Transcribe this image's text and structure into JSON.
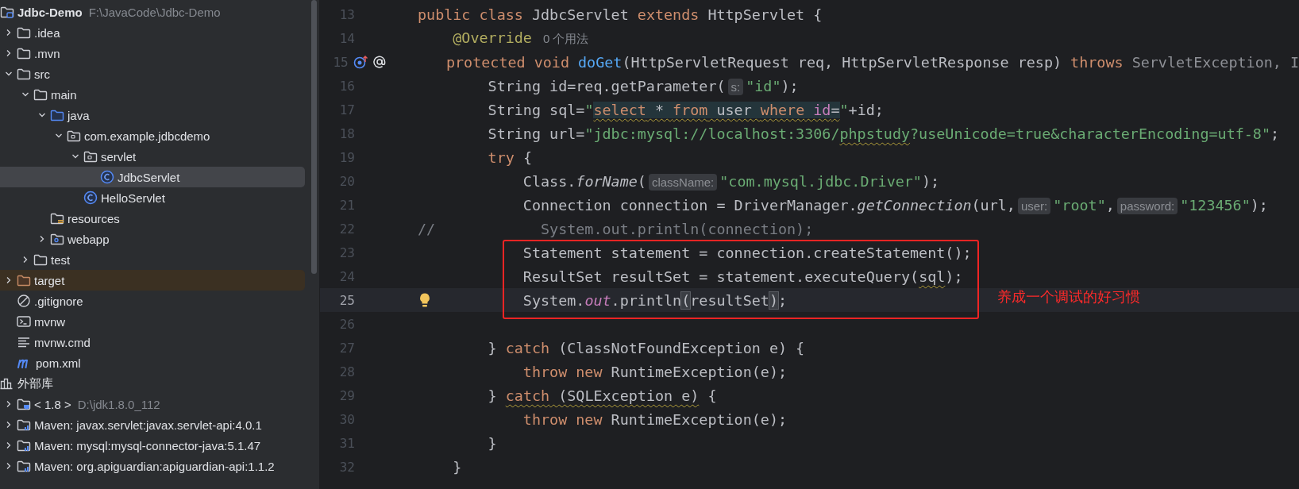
{
  "project_tree": [
    {
      "label": "Jdbc-Demo",
      "secondary": "F:\\JavaCode\\Jdbc-Demo",
      "kind": "project",
      "selected": false,
      "children": [
        {
          "label": ".idea",
          "kind": "folder",
          "expanded": false,
          "selected": false
        },
        {
          "label": ".mvn",
          "kind": "folder",
          "expanded": false,
          "selected": false
        },
        {
          "label": "src",
          "kind": "folder",
          "expanded": true,
          "selected": false,
          "children": [
            {
              "label": "main",
              "kind": "folder",
              "expanded": true,
              "selected": false,
              "children": [
                {
                  "label": "java",
                  "kind": "source-folder",
                  "expanded": true,
                  "selected": false,
                  "children": [
                    {
                      "label": "com.example.jdbcdemo",
                      "kind": "package",
                      "expanded": true,
                      "selected": false,
                      "children": [
                        {
                          "label": "servlet",
                          "kind": "package",
                          "expanded": true,
                          "selected": false,
                          "children": [
                            {
                              "label": "JdbcServlet",
                              "kind": "class",
                              "selected": true
                            }
                          ]
                        },
                        {
                          "label": "HelloServlet",
                          "kind": "class",
                          "selected": false
                        }
                      ]
                    }
                  ]
                },
                {
                  "label": "resources",
                  "kind": "resources",
                  "selected": false
                },
                {
                  "label": "webapp",
                  "kind": "web-folder",
                  "expanded": false,
                  "selected": false
                }
              ]
            },
            {
              "label": "test",
              "kind": "folder",
              "expanded": false,
              "selected": false
            }
          ]
        },
        {
          "label": "target",
          "kind": "excluded-folder",
          "expanded": false,
          "selected": false
        },
        {
          "label": ".gitignore",
          "kind": "ignore",
          "selected": false
        },
        {
          "label": "mvnw",
          "kind": "terminal",
          "selected": false
        },
        {
          "label": "mvnw.cmd",
          "kind": "text",
          "selected": false
        },
        {
          "label": "pom.xml",
          "kind": "maven",
          "selected": false
        }
      ]
    },
    {
      "label": "外部库",
      "kind": "library",
      "selected": false,
      "children": [
        {
          "label": "< 1.8 >",
          "secondary": "D:\\jdk1.8.0_112",
          "kind": "jdk",
          "expanded": false,
          "selected": false
        },
        {
          "label": "Maven: javax.servlet:javax.servlet-api:4.0.1",
          "kind": "maven-lib",
          "expanded": false,
          "selected": false
        },
        {
          "label": "Maven: mysql:mysql-connector-java:5.1.47",
          "kind": "maven-lib",
          "expanded": false,
          "selected": false
        },
        {
          "label": "Maven: org.apiguardian:apiguardian-api:1.1.2",
          "kind": "maven-lib",
          "expanded": false,
          "selected": false
        }
      ]
    }
  ],
  "editor": {
    "lines": [
      {
        "number": "13",
        "current": false,
        "tokens": [
          {
            "text": "public class ",
            "kind": "kw"
          },
          {
            "text": "JdbcServlet ",
            "kind": "plain"
          },
          {
            "text": "extends ",
            "kind": "kw"
          },
          {
            "text": "HttpServlet {",
            "kind": "plain"
          }
        ]
      },
      {
        "number": "14",
        "current": false,
        "tokens": [
          {
            "text": "    @Override",
            "kind": "ann"
          },
          {
            "text": "0 个用法",
            "kind": "usage"
          }
        ]
      },
      {
        "number": "15",
        "current": false,
        "markers": [
          {
            "kind": "override"
          },
          {
            "kind": "annotation"
          }
        ],
        "tokens": [
          {
            "text": "    protected void ",
            "kind": "kw"
          },
          {
            "text": "doGet",
            "kind": "fn"
          },
          {
            "text": "(HttpServletRequest req, HttpServletResponse resp) ",
            "kind": "plain"
          },
          {
            "text": "throws ",
            "kind": "kw"
          },
          {
            "text": "ServletException, I",
            "kind": "muted"
          }
        ]
      },
      {
        "number": "16",
        "current": false,
        "tokens": [
          {
            "text": "        String id=req.getParameter(",
            "kind": "plain"
          },
          {
            "text": "s:",
            "kind": "hint"
          },
          {
            "text": "\"id\"",
            "kind": "str"
          },
          {
            "text": ");",
            "kind": "plain"
          }
        ]
      },
      {
        "number": "17",
        "current": false,
        "tokens": [
          {
            "text": "        String sql=",
            "kind": "plain"
          },
          {
            "text": "\"",
            "kind": "str"
          },
          {
            "text": "select",
            "kind": "kw",
            "wavy": true,
            "injected": true
          },
          {
            "text": " * ",
            "kind": "plain",
            "wavy": true,
            "injected": true
          },
          {
            "text": "from",
            "kind": "kw",
            "wavy": true,
            "injected": true
          },
          {
            "text": " user ",
            "kind": "plain",
            "wavy": true,
            "injected": true
          },
          {
            "text": "where",
            "kind": "kw",
            "wavy": true,
            "injected": true
          },
          {
            "text": " id",
            "kind": "field",
            "wavy": true,
            "injected": true
          },
          {
            "text": "=",
            "kind": "plain",
            "wavy": true,
            "injected": true
          },
          {
            "text": "\"",
            "kind": "str"
          },
          {
            "text": "+id;",
            "kind": "plain"
          }
        ]
      },
      {
        "number": "18",
        "current": false,
        "tokens": [
          {
            "text": "        String url=",
            "kind": "plain"
          },
          {
            "text": "\"jdbc:mysql://localhost:3306/",
            "kind": "str"
          },
          {
            "text": "phpstudy",
            "kind": "str",
            "wavy": true
          },
          {
            "text": "?useUnicode=true&characterEncoding=utf-8\"",
            "kind": "str"
          },
          {
            "text": ";",
            "kind": "plain"
          }
        ]
      },
      {
        "number": "19",
        "current": false,
        "tokens": [
          {
            "text": "        try ",
            "kind": "kw"
          },
          {
            "text": "{",
            "kind": "plain"
          }
        ]
      },
      {
        "number": "20",
        "current": false,
        "tokens": [
          {
            "text": "            Class.",
            "kind": "plain"
          },
          {
            "text": "forName",
            "kind": "italic"
          },
          {
            "text": "(",
            "kind": "plain"
          },
          {
            "text": "className:",
            "kind": "hint"
          },
          {
            "text": "\"com.mysql.jdbc.Driver\"",
            "kind": "str"
          },
          {
            "text": ");",
            "kind": "plain"
          }
        ]
      },
      {
        "number": "21",
        "current": false,
        "tokens": [
          {
            "text": "            Connection connection = DriverManager.",
            "kind": "plain"
          },
          {
            "text": "getConnection",
            "kind": "italic"
          },
          {
            "text": "(url,",
            "kind": "plain"
          },
          {
            "text": "user:",
            "kind": "hint"
          },
          {
            "text": "\"root\"",
            "kind": "str"
          },
          {
            "text": ",",
            "kind": "plain"
          },
          {
            "text": "password:",
            "kind": "hint"
          },
          {
            "text": "\"123456\"",
            "kind": "str"
          },
          {
            "text": ");",
            "kind": "plain"
          }
        ]
      },
      {
        "number": "22",
        "current": false,
        "tokens": [
          {
            "text": "//            System.out.println(connection);",
            "kind": "comment"
          }
        ]
      },
      {
        "number": "23",
        "current": false,
        "tokens": [
          {
            "text": "            Statement statement = connection.createStatement();",
            "kind": "plain"
          }
        ]
      },
      {
        "number": "24",
        "current": false,
        "tokens": [
          {
            "text": "            ResultSet resultSet = statement.executeQuery(",
            "kind": "plain"
          },
          {
            "text": "sql",
            "kind": "plain",
            "wavy": true
          },
          {
            "text": ");",
            "kind": "plain"
          }
        ]
      },
      {
        "number": "25",
        "current": true,
        "markers": [
          {
            "kind": "bulb"
          }
        ],
        "tokens": [
          {
            "text": "            System.",
            "kind": "plain"
          },
          {
            "text": "out",
            "kind": "field-italic"
          },
          {
            "text": ".println",
            "kind": "plain"
          },
          {
            "text": "(",
            "kind": "match"
          },
          {
            "text": "resultSet",
            "kind": "plain"
          },
          {
            "text": ")",
            "kind": "match"
          },
          {
            "text": ";",
            "kind": "plain"
          }
        ]
      },
      {
        "number": "26",
        "current": false
      },
      {
        "number": "27",
        "current": false,
        "tokens": [
          {
            "text": "        } ",
            "kind": "plain"
          },
          {
            "text": "catch ",
            "kind": "kw"
          },
          {
            "text": "(ClassNotFoundException e) {",
            "kind": "plain"
          }
        ]
      },
      {
        "number": "28",
        "current": false,
        "tokens": [
          {
            "text": "            throw new ",
            "kind": "kw"
          },
          {
            "text": "RuntimeException(e);",
            "kind": "plain"
          }
        ]
      },
      {
        "number": "29",
        "current": false,
        "tokens": [
          {
            "text": "        } ",
            "kind": "plain"
          },
          {
            "text": "catch",
            "kind": "kw",
            "wavy": true
          },
          {
            "text": " (SQLException e)",
            "kind": "plain",
            "wavy": true
          },
          {
            "text": " {",
            "kind": "plain"
          }
        ]
      },
      {
        "number": "30",
        "current": false,
        "tokens": [
          {
            "text": "            throw new ",
            "kind": "kw"
          },
          {
            "text": "RuntimeException(e);",
            "kind": "plain"
          }
        ]
      },
      {
        "number": "31",
        "current": false,
        "tokens": [
          {
            "text": "        }",
            "kind": "plain"
          }
        ]
      },
      {
        "number": "32",
        "current": false,
        "tokens": [
          {
            "text": "    }",
            "kind": "plain"
          }
        ]
      }
    ]
  },
  "annotation": {
    "text": "养成一个调试的好习惯"
  }
}
